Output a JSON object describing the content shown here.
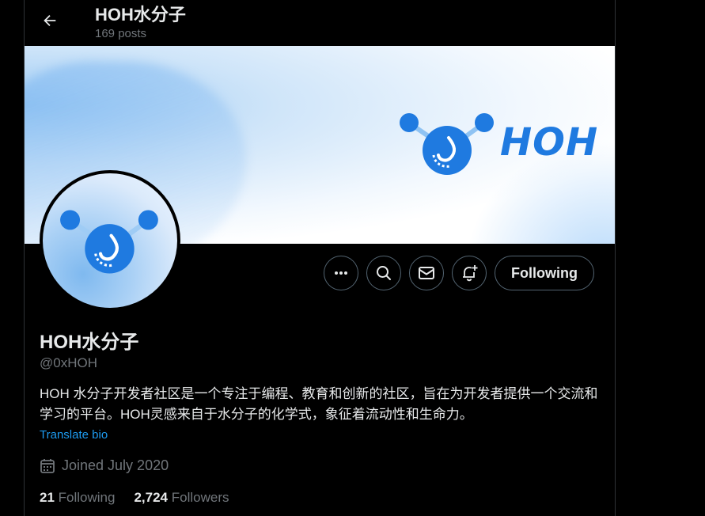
{
  "header": {
    "title": "HOH水分子",
    "post_count": "169 posts"
  },
  "banner": {
    "brand_text": "HOH",
    "logo_icon": "water-molecule-logo",
    "colors": {
      "brand": "#1f7ae0"
    }
  },
  "avatar": {
    "icon": "water-molecule-logo"
  },
  "actions": {
    "more_icon": "more-dots-icon",
    "search_icon": "search-icon",
    "message_icon": "mail-icon",
    "notify_icon": "bell-plus-icon",
    "following_label": "Following"
  },
  "profile": {
    "name": "HOH水分子",
    "handle": "@0xHOH",
    "bio": "HOH 水分子开发者社区是一个专注于编程、教育和创新的社区，旨在为开发者提供一个交流和学习的平台。HOH灵感来自于水分子的化学式，象征着流动性和生命力。",
    "translate_label": "Translate bio",
    "joined": "Joined July 2020",
    "following_count": "21",
    "following_label": "Following",
    "followers_count": "2,724",
    "followers_label": "Followers"
  },
  "colors": {
    "background": "#000000",
    "text": "#e7e9ea",
    "muted": "#71767b",
    "link": "#1d9bf0",
    "border": "#536471"
  }
}
